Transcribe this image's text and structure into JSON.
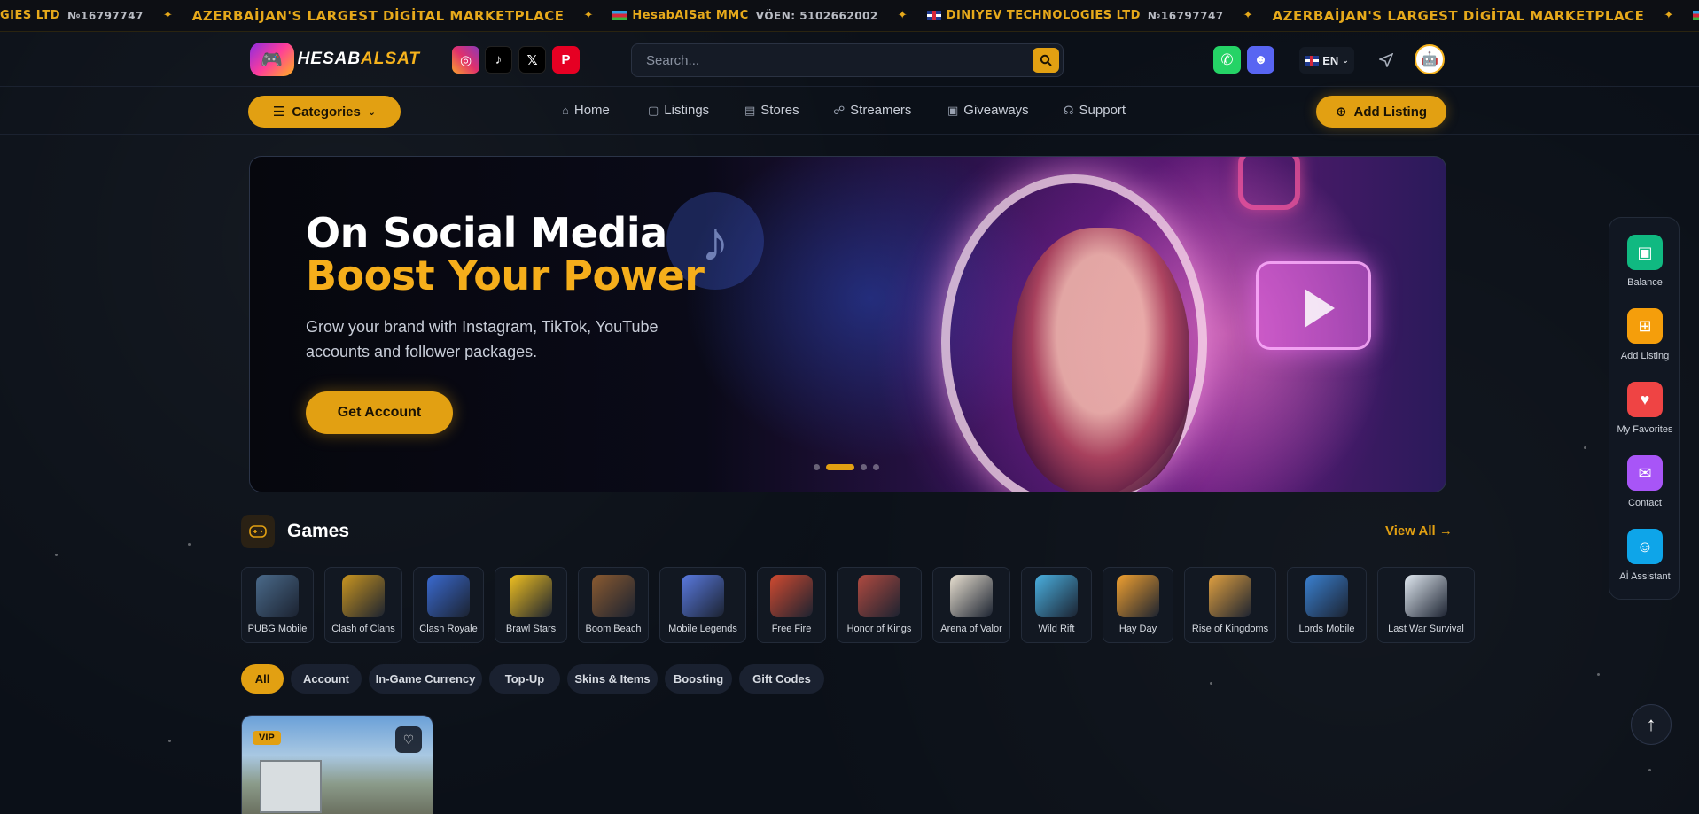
{
  "ticker": {
    "items": [
      {
        "type": "text",
        "text": "GIES LTD",
        "small": "№16797747"
      },
      {
        "type": "gold",
        "text": "AZERBAİJAN'S LARGEST DİGİTAL MARKETPLACE"
      },
      {
        "type": "text",
        "flag": "az",
        "text": "HesabAlSat MMC",
        "small": "VÖEN: 5102662002"
      },
      {
        "type": "text",
        "flag": "gb",
        "text": "DINIYEV TECHNOLOGIES LTD",
        "small": "№16797747"
      },
      {
        "type": "gold",
        "text": "AZERBAİJAN'S LARGEST DİGİTAL MARKETPLACE"
      },
      {
        "type": "text",
        "flag": "az",
        "text": "HesabAlSat MMC",
        "small": ""
      }
    ]
  },
  "header": {
    "logo_text_a": "HESAB",
    "logo_text_b": "ALSAT",
    "socials": [
      {
        "name": "instagram",
        "icon": "◎",
        "color": "#e1306c"
      },
      {
        "name": "tiktok",
        "icon": "♪",
        "color": "#000000"
      },
      {
        "name": "x",
        "icon": "𝕏",
        "color": "#000000"
      },
      {
        "name": "pinterest",
        "icon": "P",
        "color": "#e60023"
      }
    ],
    "search_placeholder": "Search...",
    "whatsapp_color": "#25d366",
    "discord_color": "#5865f2",
    "lang": "EN"
  },
  "nav": {
    "categories": "Categories",
    "items": [
      {
        "label": "Home",
        "icon": "⌂"
      },
      {
        "label": "Listings",
        "icon": "▢"
      },
      {
        "label": "Stores",
        "icon": "▤"
      },
      {
        "label": "Streamers",
        "icon": "☍"
      },
      {
        "label": "Giveaways",
        "icon": "▣"
      },
      {
        "label": "Support",
        "icon": "☊"
      }
    ],
    "add_listing": "Add Listing"
  },
  "hero": {
    "line1": "On Social Media",
    "line2": "Boost Your Power",
    "description": "Grow your brand with Instagram, TikTok, YouTube accounts and follower packages.",
    "cta": "Get Account",
    "slides": 4,
    "active_slide": 1
  },
  "games": {
    "title": "Games",
    "view_all": "View All →",
    "items": [
      {
        "label": "PUBG Mobile",
        "color": "#4a6a8a"
      },
      {
        "label": "Clash of Clans",
        "color": "#c99520"
      },
      {
        "label": "Clash Royale",
        "color": "#3a6ad0"
      },
      {
        "label": "Brawl Stars",
        "color": "#f0c020"
      },
      {
        "label": "Boom Beach",
        "color": "#8a5a30"
      },
      {
        "label": "Mobile Legends",
        "color": "#5a7ae0"
      },
      {
        "label": "Free Fire",
        "color": "#d04a30"
      },
      {
        "label": "Honor of Kings",
        "color": "#b04a40"
      },
      {
        "label": "Arena of Valor",
        "color": "#e8e0d0"
      },
      {
        "label": "Wild Rift",
        "color": "#4ab0e0"
      },
      {
        "label": "Hay Day",
        "color": "#f0a030"
      },
      {
        "label": "Rise of Kingdoms",
        "color": "#e0a040"
      },
      {
        "label": "Lords Mobile",
        "color": "#3a80d0"
      },
      {
        "label": "Last War Survival",
        "color": "#e0e8f0"
      }
    ]
  },
  "filters": [
    "All",
    "Account",
    "In-Game Currency",
    "Top-Up",
    "Skins & Items",
    "Boosting",
    "Gift Codes"
  ],
  "listing": {
    "badge": "VIP"
  },
  "dock": [
    {
      "label": "Balance",
      "icon": "▣",
      "color": "#10b981"
    },
    {
      "label": "Add Listing",
      "icon": "⊞",
      "color": "#f59e0b"
    },
    {
      "label": "My Favorites",
      "icon": "♥",
      "color": "#ef4444"
    },
    {
      "label": "Contact",
      "icon": "✉",
      "color": "#a855f7"
    },
    {
      "label": "Aİ Assistant",
      "icon": "☺",
      "color": "#0ea5e9"
    }
  ]
}
